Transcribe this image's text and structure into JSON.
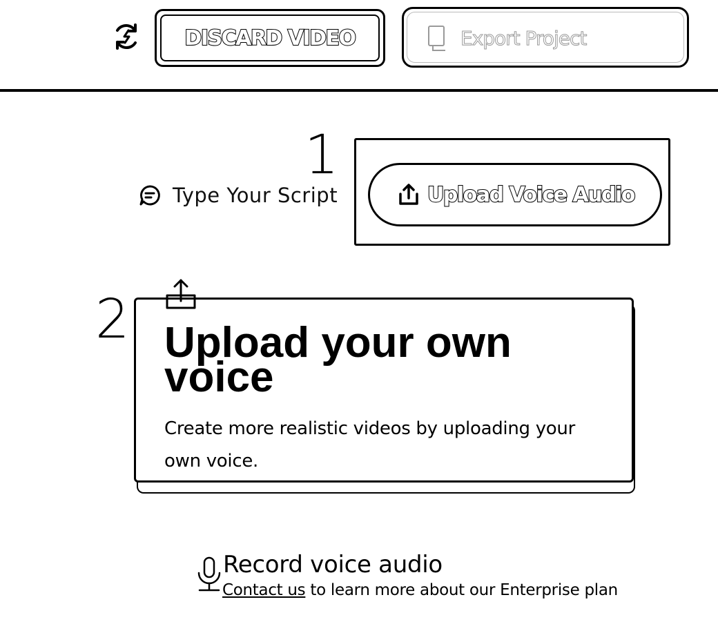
{
  "toolbar": {
    "refresh_icon": "refresh-icon",
    "discard_label": "DISCARD VIDEO",
    "export_icon": "export-icon",
    "export_label": "Export Project"
  },
  "steps": {
    "step_1": "1",
    "step_2": "2"
  },
  "tabs": {
    "script": {
      "icon": "chat-icon",
      "label": "Type Your Script"
    },
    "upload": {
      "icon": "upload-icon",
      "label": "Upload Voice Audio"
    }
  },
  "upload_card": {
    "icon": "upload-icon",
    "title": "Upload your own voice",
    "description": "Create more realistic videos by uploading your own voice."
  },
  "record": {
    "icon": "microphone-icon",
    "label": "Record voice audio",
    "link_text": "Contact us",
    "rest_text": "to learn more about our Enterprise plan"
  }
}
